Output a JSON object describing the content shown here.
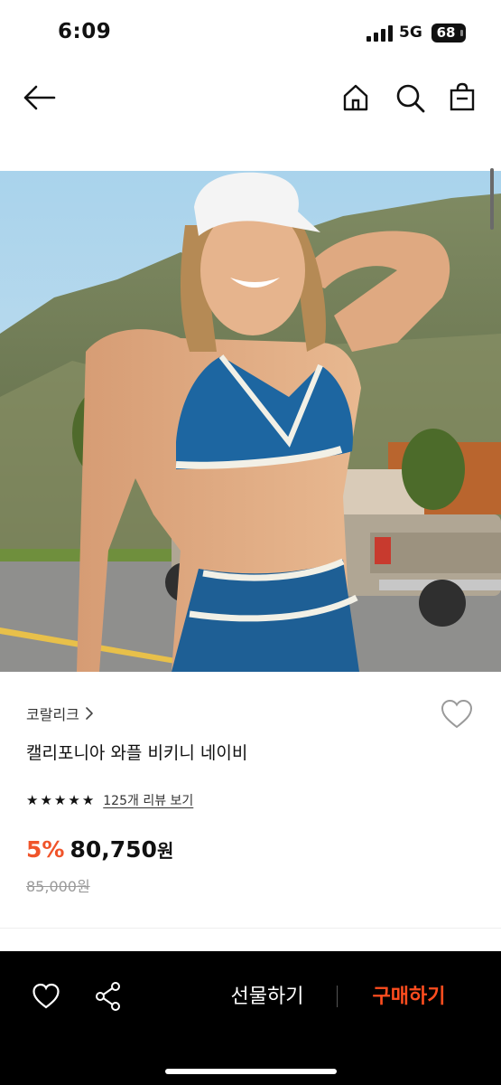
{
  "status_bar": {
    "time": "6:09",
    "network": "5G",
    "battery": "68"
  },
  "app_bar": {
    "back_icon": "arrow-left-icon",
    "home_icon": "home-icon",
    "search_icon": "search-icon",
    "bag_icon": "shopping-bag-icon"
  },
  "product": {
    "brand": "코랄리크",
    "title": "캘리포니아 와플 비키니 네이비",
    "rating_stars": 5,
    "review_link": "125개 리뷰 보기",
    "discount": "5%",
    "price": "80,750",
    "price_unit": "원",
    "original_price": "85,000원"
  },
  "bottom_bar": {
    "gift_label": "선물하기",
    "buy_label": "구매하기"
  },
  "colors": {
    "accent": "#f0542a",
    "buy": "#ff4d1f",
    "bottom_bar_bg": "#000000"
  }
}
